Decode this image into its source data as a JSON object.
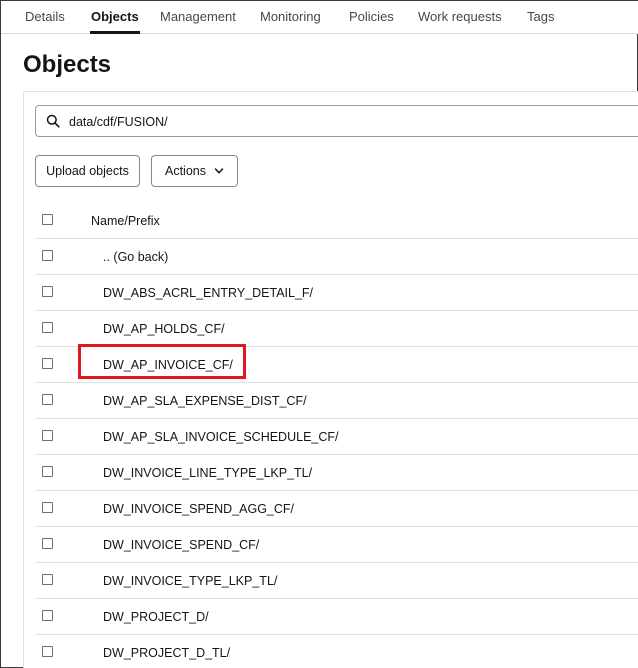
{
  "tabs": [
    {
      "label": "Details"
    },
    {
      "label": "Objects"
    },
    {
      "label": "Management"
    },
    {
      "label": "Monitoring"
    },
    {
      "label": "Policies"
    },
    {
      "label": "Work requests"
    },
    {
      "label": "Tags"
    }
  ],
  "page": {
    "title": "Objects"
  },
  "search": {
    "value": "data/cdf/FUSION/"
  },
  "toolbar": {
    "upload_label": "Upload objects",
    "actions_label": "Actions"
  },
  "table": {
    "header": "Name/Prefix",
    "rows": [
      ".. (Go back)",
      "DW_ABS_ACRL_ENTRY_DETAIL_F/",
      "DW_AP_HOLDS_CF/",
      "DW_AP_INVOICE_CF/",
      "DW_AP_SLA_EXPENSE_DIST_CF/",
      "DW_AP_SLA_INVOICE_SCHEDULE_CF/",
      "DW_INVOICE_LINE_TYPE_LKP_TL/",
      "DW_INVOICE_SPEND_AGG_CF/",
      "DW_INVOICE_SPEND_CF/",
      "DW_INVOICE_TYPE_LKP_TL/",
      "DW_PROJECT_D/",
      "DW_PROJECT_D_TL/"
    ]
  },
  "colors": {
    "highlight": "#e0171f",
    "active_tab": "#161513"
  }
}
